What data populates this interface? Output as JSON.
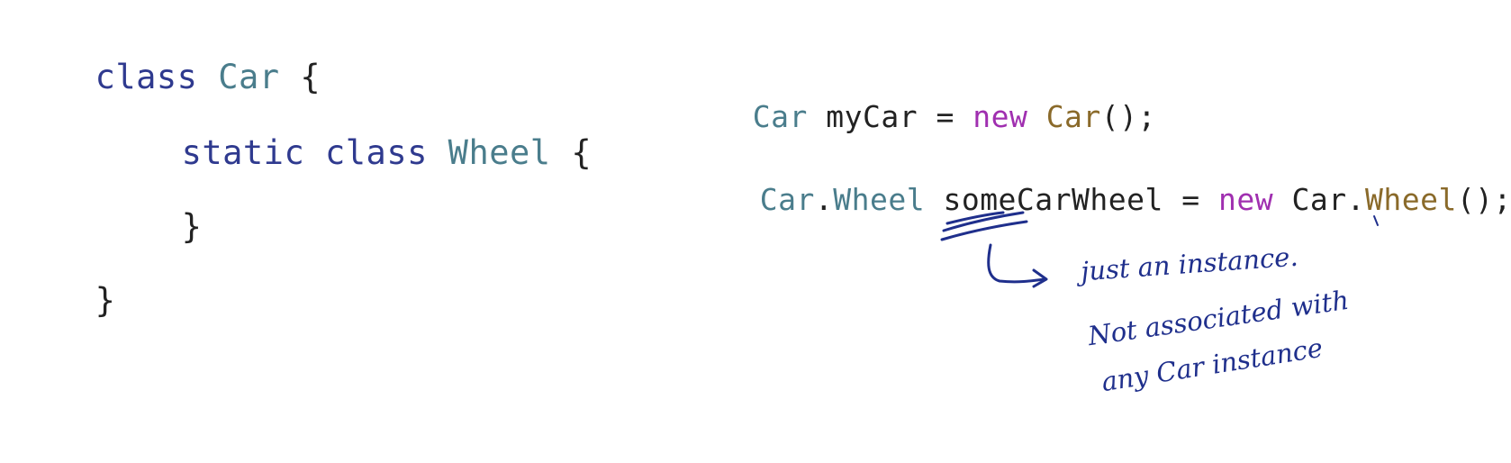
{
  "left_code": {
    "line1": {
      "kw": "class",
      "name": "Car",
      "brace": "{"
    },
    "line2": {
      "kw1": "static",
      "kw2": "class",
      "name": "Wheel",
      "brace": "{"
    },
    "line3": {
      "brace": "}"
    },
    "line4": {
      "brace": "}"
    }
  },
  "right_code": {
    "line1": {
      "type": "Car",
      "var": "myCar",
      "eq": "=",
      "kw": "new",
      "ctor": "Car",
      "tail": "();"
    },
    "line2": {
      "outer": "Car",
      "dot": ".",
      "inner": "Wheel",
      "var": "someCarWheel",
      "eq": "=",
      "kw": "new",
      "ctor_outer": "Car.",
      "ctor_inner": "Wheel",
      "tail": "();"
    }
  },
  "annotation": {
    "line1": "just an instance.",
    "line2": "Not associated with",
    "line3": "any Car instance"
  },
  "colors": {
    "keyword": "#2f3a8f",
    "type": "#4a7d8c",
    "new_keyword": "#a02fb0",
    "ctor": "#8a6a2a",
    "ink": "#1f2f8c"
  }
}
